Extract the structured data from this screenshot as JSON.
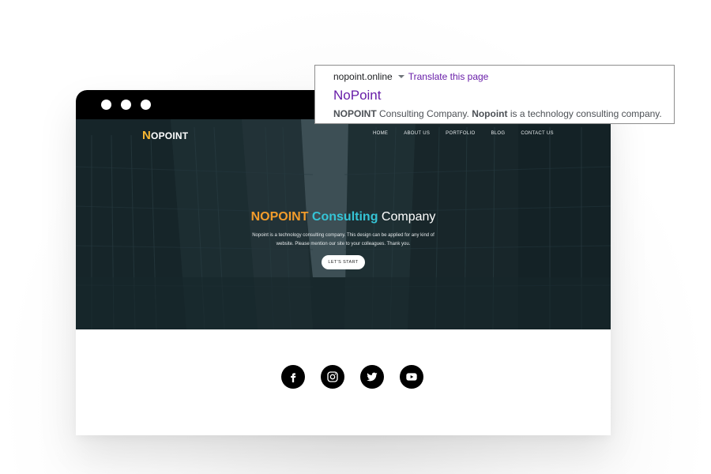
{
  "search_result": {
    "domain": "nopoint.online",
    "translate_label": "Translate this page",
    "title": "NoPoint",
    "snippet_bold_1": "NOPOINT",
    "snippet_text_1": " Consulting Company. ",
    "snippet_bold_2": "Nopoint",
    "snippet_text_2": " is a technology consulting company."
  },
  "site": {
    "logo_first": "N",
    "logo_rest": "OPOINT",
    "nav": [
      "HOME",
      "ABOUT US",
      "PORTFOLIO",
      "BLOG",
      "CONTACT US"
    ],
    "headline_1": "NOPOINT",
    "headline_2": "Consulting",
    "headline_3": "Company",
    "subtext_line1": "Nopoint is a technology consulting company. This design can be applied for any kind of",
    "subtext_line2": "website. Please mention our site to your colleagues. Thank you.",
    "cta_label": "LET'S START",
    "social": [
      "facebook-icon",
      "instagram-icon",
      "twitter-icon",
      "youtube-icon"
    ]
  },
  "colors": {
    "accent_orange": "#f39c2b",
    "accent_cyan": "#35c4d6",
    "logo_yellow": "#f7b733",
    "link_purple": "#681da8"
  }
}
